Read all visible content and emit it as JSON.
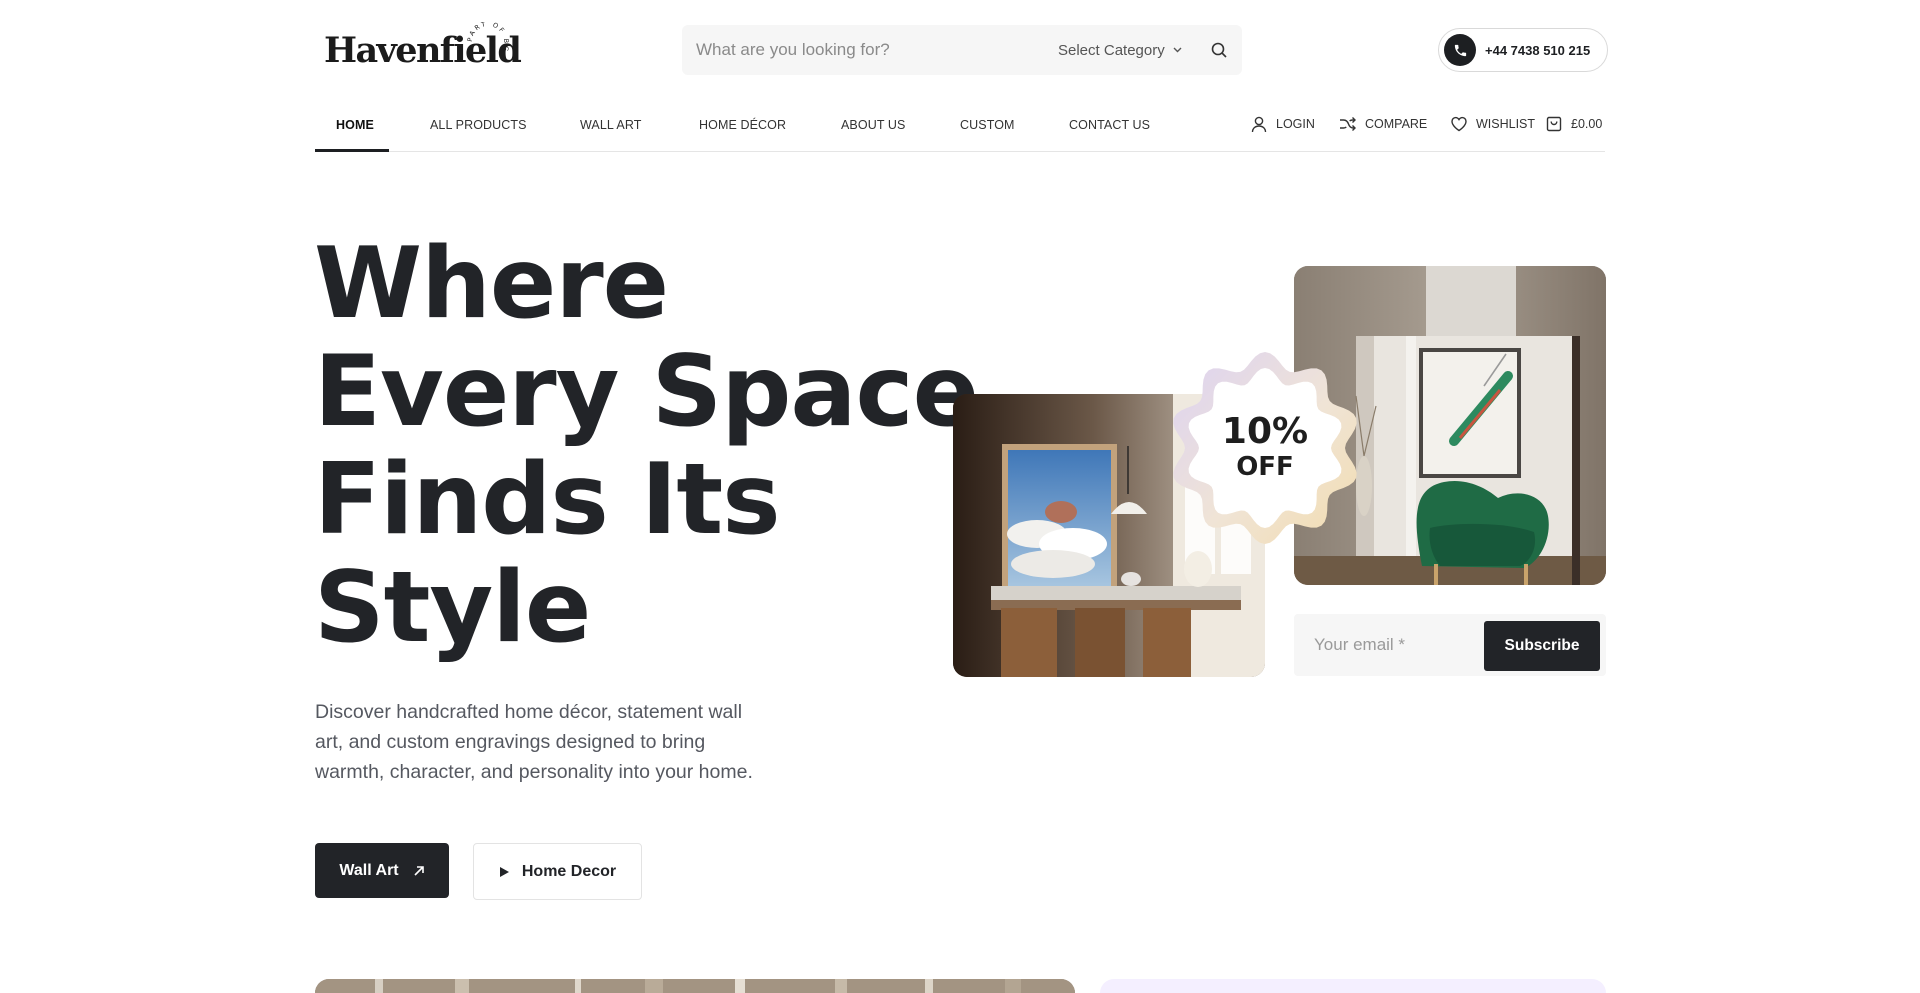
{
  "brand": {
    "name": "Havenfield",
    "tagline": "PART OF BG"
  },
  "search": {
    "placeholder": "What are you looking for?",
    "category_label": "Select Category"
  },
  "contact": {
    "phone": "+44 7438 510 215"
  },
  "nav": {
    "items": [
      {
        "label": "HOME",
        "active": true
      },
      {
        "label": "ALL PRODUCTS"
      },
      {
        "label": "WALL ART"
      },
      {
        "label": "HOME DÉCOR"
      },
      {
        "label": "ABOUT US"
      },
      {
        "label": "CUSTOM"
      },
      {
        "label": "CONTACT US"
      }
    ],
    "utilities": {
      "login": "LOGIN",
      "compare": "COMPARE",
      "wishlist": "WISHLIST",
      "cart_total": "£0.00"
    }
  },
  "hero": {
    "title_lines": [
      "Where",
      "Every Space",
      "Finds Its",
      "Style"
    ],
    "description": "Discover handcrafted home décor, statement wall art, and custom engravings designed to bring warmth, character, and personality into your home.",
    "primary_button": "Wall Art",
    "secondary_button": "Home Decor"
  },
  "promo": {
    "discount": "10%",
    "off": "OFF",
    "email_placeholder": "Your email *",
    "subscribe": "Subscribe"
  },
  "colors": {
    "primary": "#222428",
    "accent_badge": "#e3d6f0",
    "chair_green": "#1f6b45"
  },
  "icons": {
    "phone": "phone-icon",
    "search": "search-icon",
    "login": "user-icon",
    "compare": "shuffle-icon",
    "wishlist": "heart-icon",
    "cart": "bag-icon"
  }
}
